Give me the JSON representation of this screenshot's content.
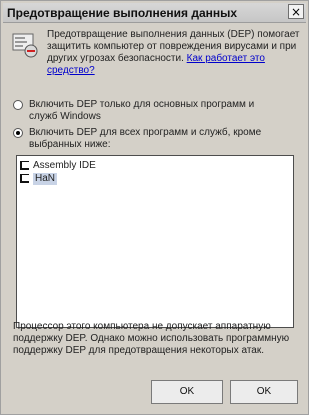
{
  "window": {
    "title": "Предотвращение выполнения данных",
    "close_glyph": "×"
  },
  "intro": {
    "text": "Предотвращение выполнения данных (DEP) помогает защитить компьютер от повреждения вирусами и при других угрозах безопасности.",
    "link": "Как работает это средство?",
    "icon": "dep-shield-icon"
  },
  "radios": [
    {
      "label": "Включить DEP только для основных программ и служб Windows",
      "selected": false
    },
    {
      "label": "Включить DEP для всех программ и служб, кроме выбранных ниже:",
      "selected": true
    }
  ],
  "exceptions_list": [
    {
      "label": "Assembly IDE",
      "selected": false
    },
    {
      "label": "HaN",
      "selected": true
    }
  ],
  "info": {
    "text": "Процессор этого компьютера не допускает аппаратную поддержку DEP. Однако можно использовать программную поддержку DEP для предотвращения некоторых атак."
  },
  "buttons": {
    "ok_1": "OK",
    "ok_2": "OK"
  }
}
